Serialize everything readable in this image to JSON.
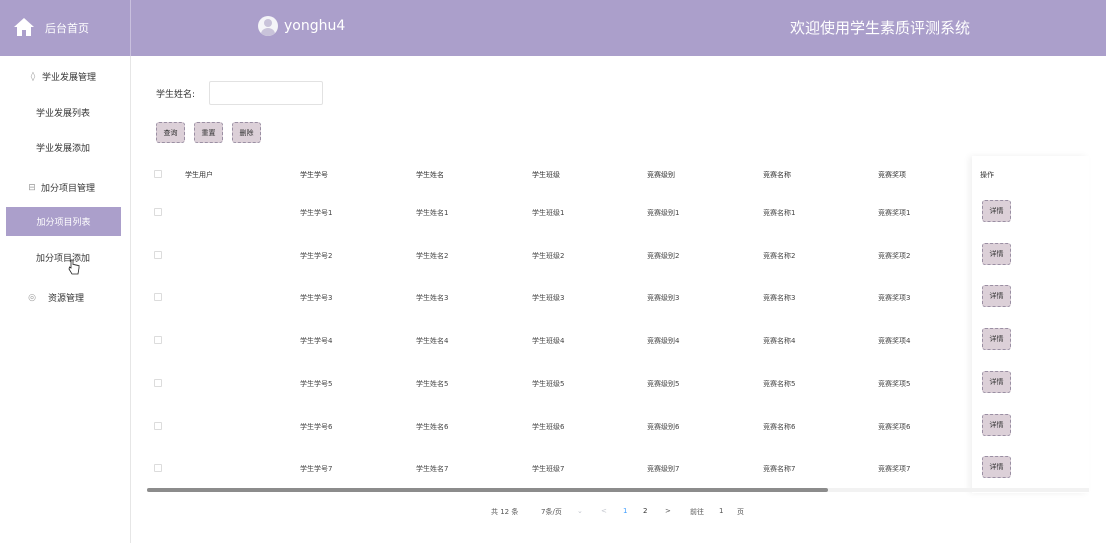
{
  "header": {
    "home_label": "后台首页",
    "username": "yonghu4",
    "system_title": "欢迎使用学生素质评测系统",
    "bg_color": "#ab9fcb"
  },
  "sidebar": {
    "groups": [
      {
        "label": "学业发展管理",
        "icon": "leaf-icon"
      },
      {
        "label": "加分项目管理",
        "icon": "gift-icon"
      },
      {
        "label": "资源管理",
        "icon": "compass-icon"
      }
    ],
    "items": [
      {
        "label": "学业发展列表"
      },
      {
        "label": "学业发展添加"
      },
      {
        "label": "加分项目列表",
        "active": true
      },
      {
        "label": "加分项目添加"
      }
    ]
  },
  "search": {
    "label": "学生姓名:",
    "value": "",
    "placeholder": ""
  },
  "buttons": {
    "query": "查询",
    "reset": "重置",
    "delete": "删除"
  },
  "table": {
    "columns": [
      "学生用户",
      "学生学号",
      "学生姓名",
      "学生班级",
      "竞赛级别",
      "竞赛名称",
      "竞赛奖项",
      "操作"
    ],
    "rows": [
      {
        "user": "",
        "sid": "学生学号1",
        "name": "学生姓名1",
        "cls": "学生班级1",
        "level": "竞赛级别1",
        "comp": "竞赛名称1",
        "award": "竞赛奖项1",
        "action": "详情"
      },
      {
        "user": "",
        "sid": "学生学号2",
        "name": "学生姓名2",
        "cls": "学生班级2",
        "level": "竞赛级别2",
        "comp": "竞赛名称2",
        "award": "竞赛奖项2",
        "action": "详情"
      },
      {
        "user": "",
        "sid": "学生学号3",
        "name": "学生姓名3",
        "cls": "学生班级3",
        "level": "竞赛级别3",
        "comp": "竞赛名称3",
        "award": "竞赛奖项3",
        "action": "详情"
      },
      {
        "user": "",
        "sid": "学生学号4",
        "name": "学生姓名4",
        "cls": "学生班级4",
        "level": "竞赛级别4",
        "comp": "竞赛名称4",
        "award": "竞赛奖项4",
        "action": "详情"
      },
      {
        "user": "",
        "sid": "学生学号5",
        "name": "学生姓名5",
        "cls": "学生班级5",
        "level": "竞赛级别5",
        "comp": "竞赛名称5",
        "award": "竞赛奖项5",
        "action": "详情"
      },
      {
        "user": "",
        "sid": "学生学号6",
        "name": "学生姓名6",
        "cls": "学生班级6",
        "level": "竞赛级别6",
        "comp": "竞赛名称6",
        "award": "竞赛奖项6",
        "action": "详情"
      },
      {
        "user": "",
        "sid": "学生学号7",
        "name": "学生姓名7",
        "cls": "学生班级7",
        "level": "竞赛级别7",
        "comp": "竞赛名称7",
        "award": "竞赛奖项7",
        "action": "详情"
      }
    ]
  },
  "pagination": {
    "total": "共 12 条",
    "page_size": "7条/页",
    "prev": "<",
    "next": ">",
    "pages": [
      "1",
      "2"
    ],
    "current": "1",
    "goto_label": "前往",
    "goto_value": "1",
    "page_suffix": "页"
  }
}
